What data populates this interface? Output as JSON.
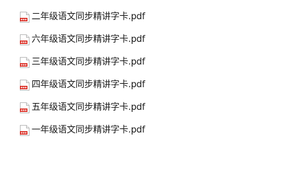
{
  "files": [
    {
      "name": "二年级语文同步精讲字卡.pdf",
      "icon": "pdf-file-icon"
    },
    {
      "name": "六年级语文同步精讲字卡.pdf",
      "icon": "pdf-file-icon"
    },
    {
      "name": "三年级语文同步精讲字卡.pdf",
      "icon": "pdf-file-icon"
    },
    {
      "name": "四年级语文同步精讲字卡.pdf",
      "icon": "pdf-file-icon"
    },
    {
      "name": "五年级语文同步精讲字卡.pdf",
      "icon": "pdf-file-icon"
    },
    {
      "name": "一年级语文同步精讲字卡.pdf",
      "icon": "pdf-file-icon"
    }
  ],
  "colors": {
    "pdf_red": "#d9261c",
    "icon_border": "#bdbdbd",
    "text": "#1a1a1a"
  }
}
